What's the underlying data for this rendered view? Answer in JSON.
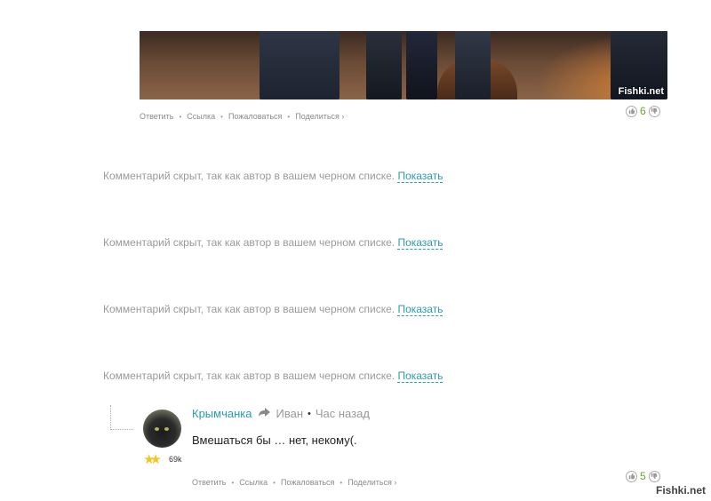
{
  "top_comment": {
    "photo_credit": "Fishki.net",
    "actions": [
      "Ответить",
      "Ссылка",
      "Пожаловаться",
      "Поделиться ›"
    ],
    "votes": "6"
  },
  "hidden_notes": [
    {
      "text": "Комментарий скрыт, так как автор в вашем черном списке.",
      "show_label": "Показать"
    },
    {
      "text": "Комментарий скрыт, так как автор в вашем черном списке.",
      "show_label": "Показать"
    },
    {
      "text": "Комментарий скрыт, так как автор в вашем черном списке.",
      "show_label": "Показать"
    },
    {
      "text": "Комментарий скрыт, так как автор в вашем черном списке.",
      "show_label": "Показать"
    }
  ],
  "reply": {
    "author": "Крымчанка",
    "reply_to": "Иван",
    "time": "Час назад",
    "text": "Вмешаться бы … нет, некому(.",
    "karma": "69k",
    "actions": [
      "Ответить",
      "Ссылка",
      "Пожаловаться",
      "Поделиться ›"
    ],
    "votes": "5"
  },
  "watermark": "Fishki.net",
  "icons": {
    "reply_arrow": "reply-arrow-icon",
    "vote_up": "thumb-up-icon",
    "vote_down": "thumb-down-icon",
    "rank": "star-icon"
  },
  "colors": {
    "link": "#2a9bb0",
    "vote_positive": "#69a62c",
    "muted_text": "#9a9a9a"
  }
}
